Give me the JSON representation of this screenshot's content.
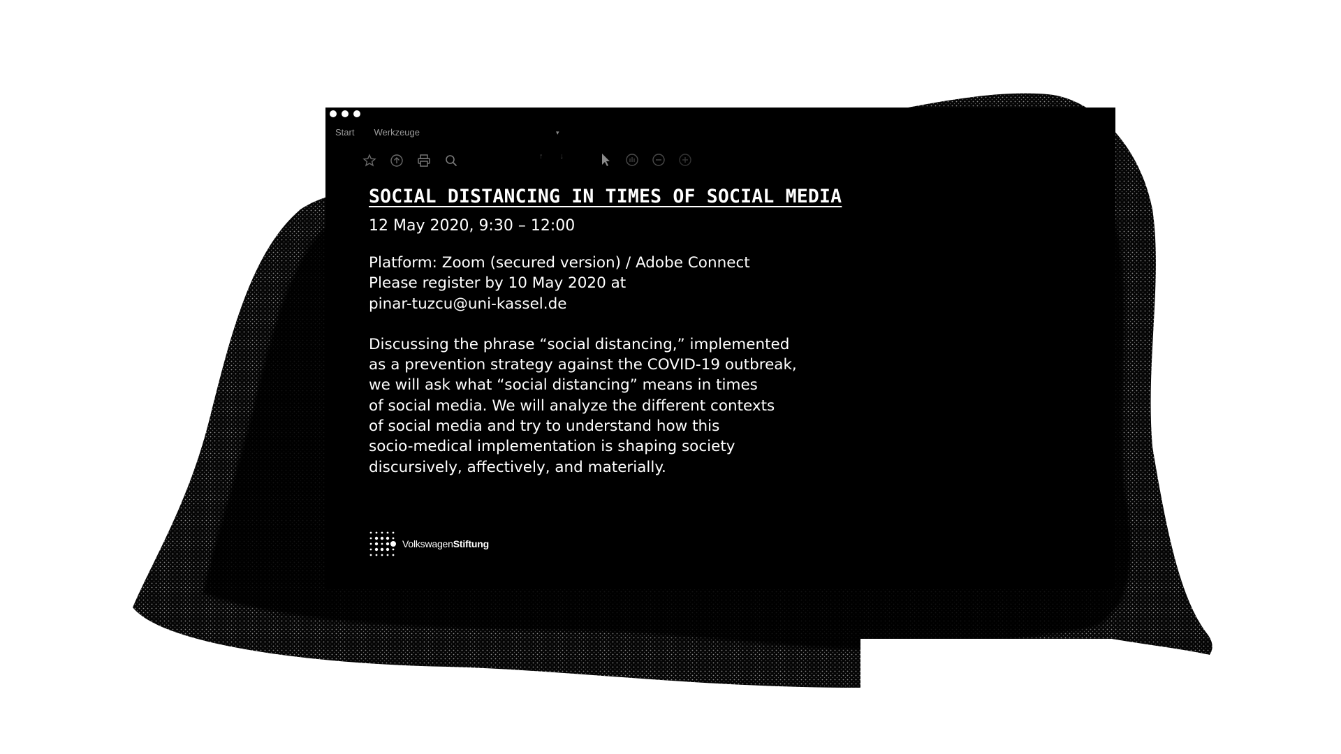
{
  "window": {
    "menu": {
      "start_label": "Start",
      "tools_label": "Werkzeuge"
    },
    "toolbar": {
      "icons": [
        "star-icon",
        "upload-icon",
        "print-icon",
        "search-icon",
        "cursor-icon",
        "hand-icon",
        "zoom-out-icon",
        "zoom-in-icon"
      ]
    }
  },
  "event": {
    "title": "SOCIAL DISTANCING IN TIMES OF SOCIAL MEDIA",
    "date": "12 May 2020, 9:30 – 12:00",
    "info_lines": [
      "Platform: Zoom (secured version) / Adobe Connect",
      "Please register by 10 May 2020 at",
      "pinar-tuzcu@uni-kassel.de"
    ],
    "description_lines": [
      "Discussing the phrase “social distancing,” implemented",
      "as a prevention strategy against the COVID-19 outbreak,",
      "we will ask what “social distancing” means in times",
      "of social media. We will analyze the different contexts",
      "of social media and try to understand how this",
      "socio-medical implementation is shaping society",
      "discursively, affectively, and materially."
    ]
  },
  "logo": {
    "name_regular": "Volkswagen",
    "name_bold": "Stiftung"
  },
  "colors": {
    "background": "#ffffff",
    "window": "#000000",
    "text": "#ffffff",
    "toolbar_muted": "#6a6a6a"
  }
}
